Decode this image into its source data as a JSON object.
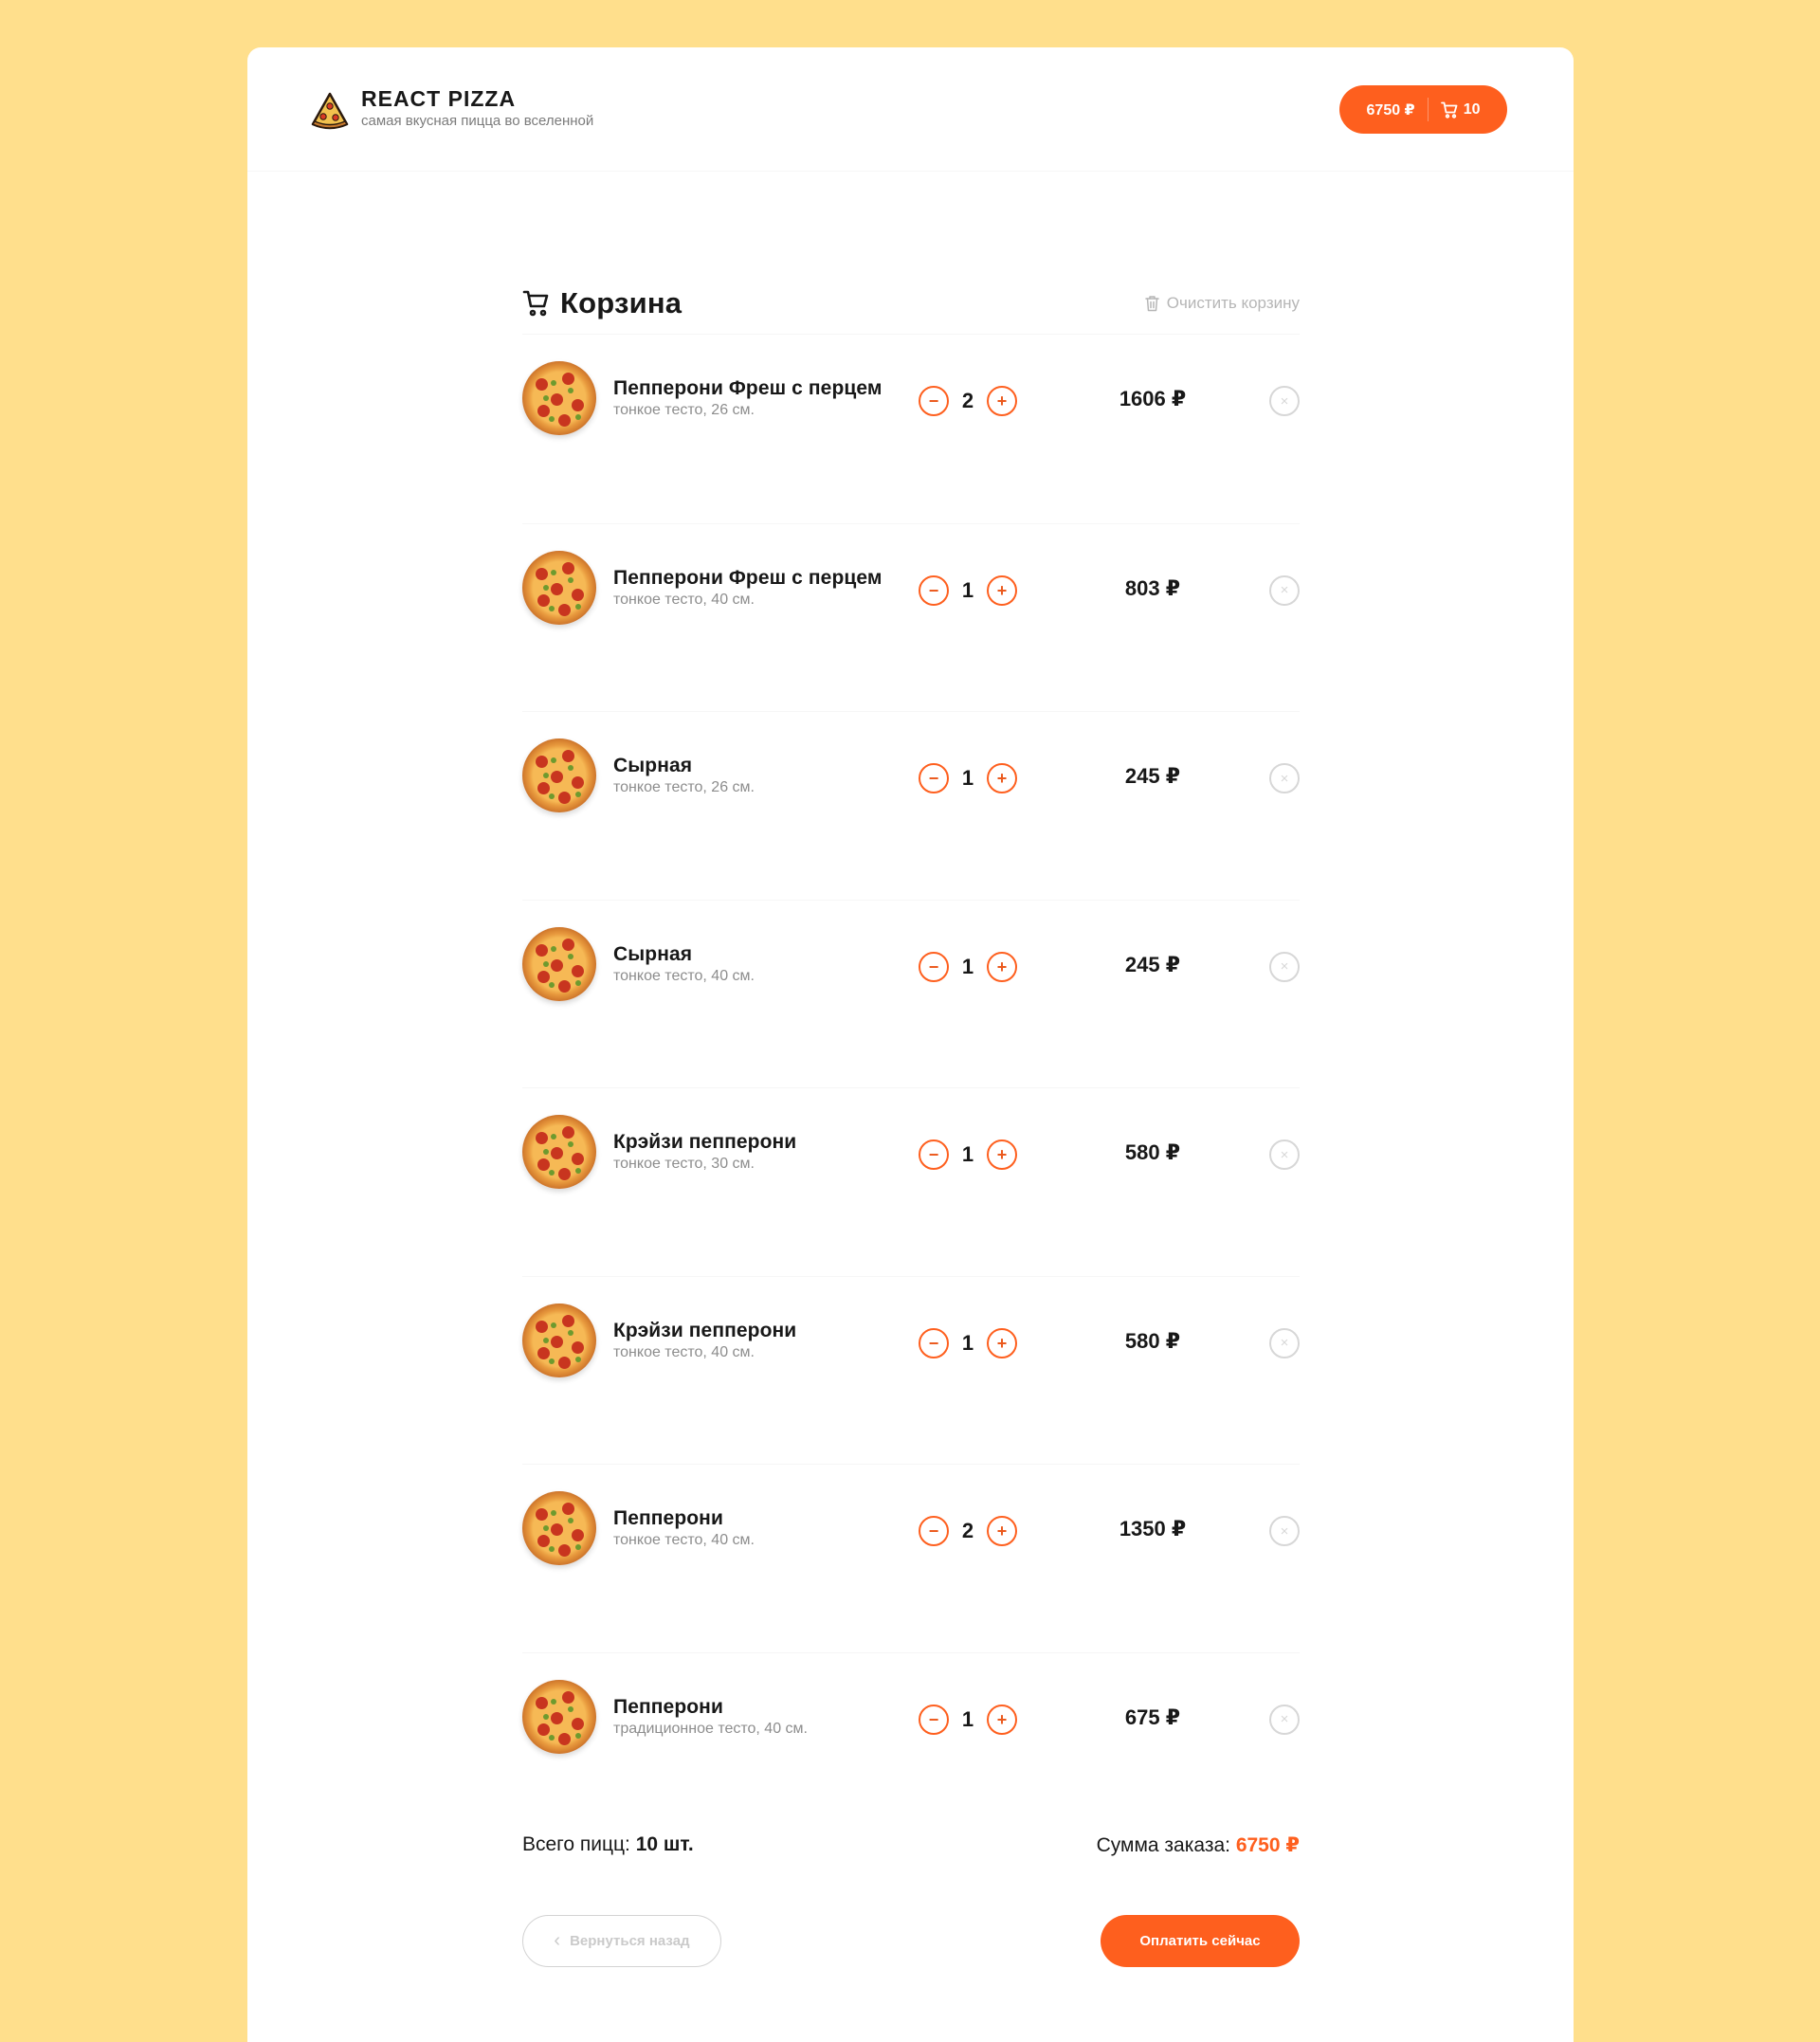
{
  "header": {
    "logo_title": "REACT PIZZA",
    "logo_subtitle": "самая вкусная пицца во вселенной",
    "cart_total": "6750 ₽",
    "cart_count": "10"
  },
  "cart": {
    "title": "Корзина",
    "clear_label": "Очистить корзину",
    "items": [
      {
        "name": "Пепперони Фреш с перцем",
        "desc": "тонкое тесто, 26 см.",
        "count": "2",
        "price": "1606 ₽"
      },
      {
        "name": "Пепперони Фреш с перцем",
        "desc": "тонкое тесто, 40 см.",
        "count": "1",
        "price": "803 ₽"
      },
      {
        "name": "Сырная",
        "desc": "тонкое тесто, 26 см.",
        "count": "1",
        "price": "245 ₽"
      },
      {
        "name": "Сырная",
        "desc": "тонкое тесто, 40 см.",
        "count": "1",
        "price": "245 ₽"
      },
      {
        "name": "Крэйзи пепперони",
        "desc": "тонкое тесто, 30 см.",
        "count": "1",
        "price": "580 ₽"
      },
      {
        "name": "Крэйзи пепперони",
        "desc": "тонкое тесто, 40 см.",
        "count": "1",
        "price": "580 ₽"
      },
      {
        "name": "Пепперони",
        "desc": "тонкое тесто, 40 см.",
        "count": "2",
        "price": "1350 ₽"
      },
      {
        "name": "Пепперони",
        "desc": "традиционное тесто, 40 см.",
        "count": "1",
        "price": "675 ₽"
      }
    ],
    "minus_label": "−",
    "plus_label": "+",
    "remove_label": "×",
    "total_label": "Всего пицц:",
    "total_value": "10 шт.",
    "sum_label": "Сумма заказа:",
    "sum_value": "6750 ₽",
    "back_label": "Вернуться назад",
    "back_chevron": "‹",
    "pay_label": "Оплатить сейчас"
  },
  "colors": {
    "background": "#FFDF8C",
    "accent": "#FE5F1E",
    "text": "#181818",
    "muted": "#7B7B7B"
  },
  "icons": {
    "logo": "pizza-slice-icon",
    "cart": "cart-icon",
    "clear": "trash-icon",
    "back": "chevron-left-icon"
  }
}
